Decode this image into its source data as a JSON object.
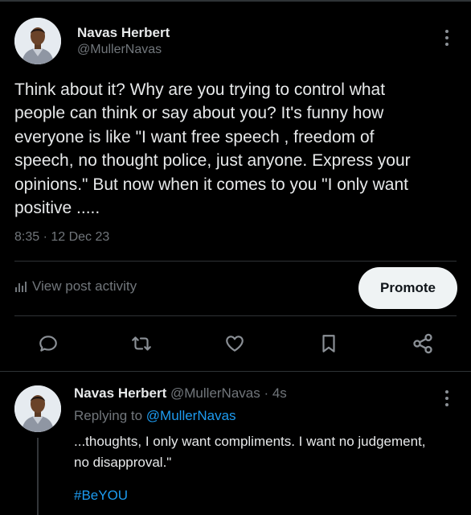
{
  "post": {
    "author_name": "Navas Herbert",
    "author_handle": "@MullerNavas",
    "text_lines": [
      "Think about it? Why are you trying to control what",
      "people can think or say about you? It's funny how",
      "everyone is like \"I want free speech , freedom of",
      "speech, no thought police, just anyone. Express your",
      "opinions.\" But now when it comes to you \"I only want",
      "positive ....."
    ],
    "timestamp": "8:35 · 12 Dec 23",
    "view_activity_label": "View post activity",
    "promote_label": "Promote"
  },
  "actions": {
    "icons": [
      "reply-icon",
      "repost-icon",
      "like-icon",
      "bookmark-icon",
      "share-icon"
    ]
  },
  "reply": {
    "author_name": "Navas Herbert",
    "author_meta": "@MullerNavas · 4s",
    "replying_prefix": "Replying to",
    "replying_handle": "@MullerNavas",
    "text_lines": [
      "...thoughts, I only want compliments. I want no judgement,",
      "no disapproval.\""
    ],
    "hashtag": "#BeYOU"
  },
  "colors": {
    "background": "#000000",
    "text_primary": "#e7e9ea",
    "text_secondary": "#71767b",
    "accent": "#1d9bf0",
    "divider": "#2f3336"
  }
}
